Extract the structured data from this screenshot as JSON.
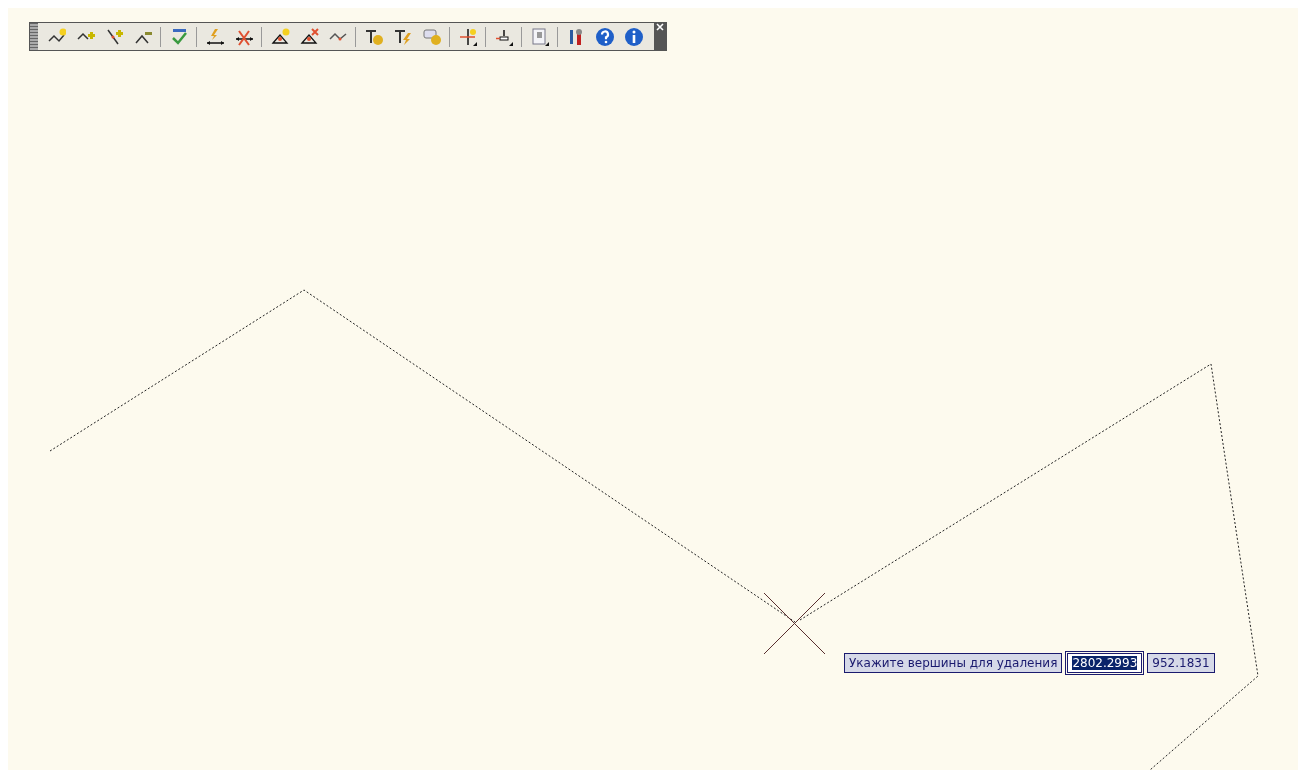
{
  "command_prompt": {
    "text": "Укажите вершины для удаления",
    "fields": [
      {
        "value": "2802.2993",
        "selected": true
      },
      {
        "value": "952.1831",
        "selected": false
      }
    ]
  }
}
